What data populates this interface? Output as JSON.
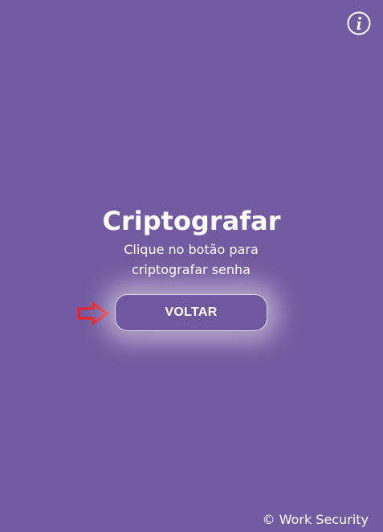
{
  "header": {
    "info_icon": "info-circle-icon"
  },
  "main": {
    "title": "Criptografar",
    "subtitle_line1": "Clique no botão para",
    "subtitle_line2": "criptografar senha",
    "pointer_icon": "right-arrow-icon",
    "back_button_label": "VOLTAR"
  },
  "footer": {
    "copyright": "© Work Security"
  },
  "colors": {
    "background": "#725ba0",
    "text": "#ffffff",
    "arrow": "#e8212a"
  }
}
